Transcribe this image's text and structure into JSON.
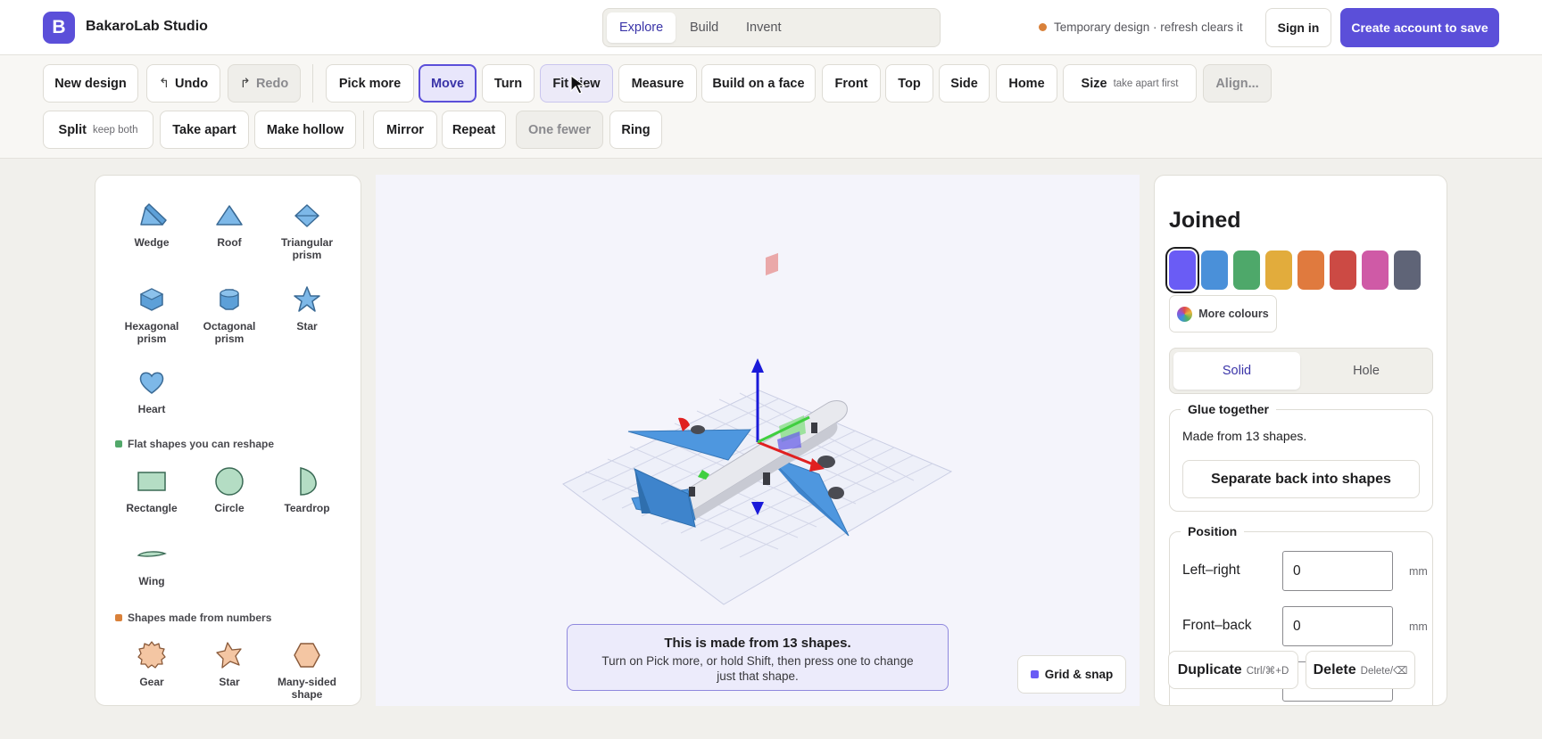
{
  "app": {
    "logo_letter": "B",
    "brand": "BakaroLab Studio",
    "accent": "#5b4fd9"
  },
  "modes": [
    {
      "label": "Explore",
      "active": true
    },
    {
      "label": "Build",
      "active": false
    },
    {
      "label": "Invent",
      "active": false
    }
  ],
  "status": {
    "text": "Temporary design · refresh clears it",
    "dot_color": "#d9813a"
  },
  "account": {
    "signin": "Sign in",
    "create": "Create account to save"
  },
  "toolbar": {
    "row1": [
      {
        "label": "New design"
      },
      {
        "label": "Undo",
        "glyph": "↰"
      },
      {
        "label": "Redo",
        "glyph": "↱",
        "disabled": true
      },
      {
        "label": "Pick more"
      },
      {
        "label": "Move",
        "active": true
      },
      {
        "label": "Turn"
      },
      {
        "label": "Fit view",
        "hover": true
      },
      {
        "label": "Measure"
      },
      {
        "label": "Build on a face"
      },
      {
        "label": "Front"
      },
      {
        "label": "Top"
      },
      {
        "label": "Side"
      },
      {
        "label": "Home"
      },
      {
        "label": "Size",
        "sub": "take apart first"
      },
      {
        "label": "Align...",
        "disabled": true
      }
    ],
    "row2": [
      {
        "label": "Split",
        "sub": "keep both"
      },
      {
        "label": "Take apart"
      },
      {
        "label": "Make hollow"
      },
      {
        "label": "Mirror"
      },
      {
        "label": "Repeat"
      },
      {
        "label": "One fewer",
        "disabled": true
      },
      {
        "label": "Ring"
      }
    ]
  },
  "palette": {
    "basic_shapes": [
      {
        "label": "Wedge",
        "icon": "wedge-icon"
      },
      {
        "label": "Roof",
        "icon": "roof-icon"
      },
      {
        "label": "Triangular prism",
        "icon": "triangular-prism-icon"
      },
      {
        "label": "Hexagonal prism",
        "icon": "hexagonal-prism-icon"
      },
      {
        "label": "Octagonal prism",
        "icon": "octagonal-prism-icon"
      },
      {
        "label": "Star",
        "icon": "star-icon"
      },
      {
        "label": "Heart",
        "icon": "heart-icon"
      }
    ],
    "flat_heading": "Flat shapes you can reshape",
    "flat_color": "#52a86a",
    "flat_shapes": [
      {
        "label": "Rectangle",
        "icon": "rectangle-icon"
      },
      {
        "label": "Circle",
        "icon": "circle-icon"
      },
      {
        "label": "Teardrop",
        "icon": "teardrop-icon"
      },
      {
        "label": "Wing",
        "icon": "wing-icon"
      }
    ],
    "number_heading": "Shapes made from numbers",
    "number_color": "#d9813a",
    "number_shapes": [
      {
        "label": "Gear",
        "icon": "gear-icon"
      },
      {
        "label": "Star",
        "icon": "star-icon"
      },
      {
        "label": "Many-sided shape",
        "icon": "polygon-icon"
      }
    ]
  },
  "viewport": {
    "info_title": "This is made from 13 shapes.",
    "info_body": "Turn on Pick more, or hold Shift, then press one to change just that shape.",
    "grid_snap": "Grid & snap"
  },
  "props": {
    "title": "Joined",
    "colors": [
      "#6a5cf5",
      "#4a90d9",
      "#4ea86a",
      "#e2ac3c",
      "#e07a3e",
      "#cc4a44",
      "#cf5aa6",
      "#5f6477"
    ],
    "selected_color_index": 0,
    "more_colours": "More colours",
    "type_tabs": [
      {
        "label": "Solid",
        "active": true
      },
      {
        "label": "Hole",
        "active": false
      }
    ],
    "glue_heading": "Glue together",
    "made_from": "Made from 13 shapes.",
    "separate": "Separate back into shapes",
    "position_heading": "Position",
    "left_right": {
      "label": "Left–right",
      "value": "0",
      "unit": "mm"
    },
    "front_back": {
      "label": "Front–back",
      "value": "0",
      "unit": "mm"
    },
    "duplicate": {
      "label": "Duplicate",
      "shortcut": "Ctrl/⌘+D"
    },
    "delete": {
      "label": "Delete",
      "shortcut": "Delete/⌫"
    }
  }
}
